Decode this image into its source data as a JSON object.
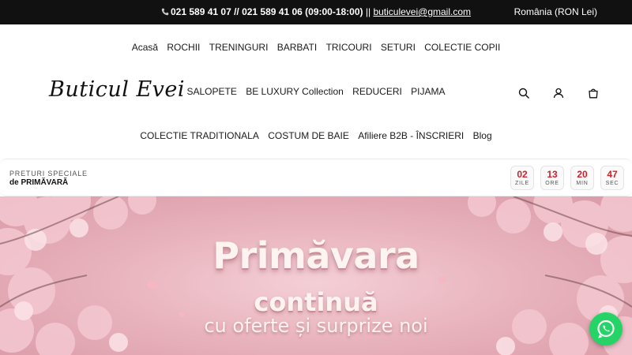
{
  "topbar": {
    "phone_text": "021 589 41 07 // 021 589 41 06 (09:00-18:00)",
    "separator": " || ",
    "email": "buticulevei@gmail.com",
    "region": "România (RON Lei)"
  },
  "header": {
    "logo": "Buticul Evei",
    "nav_row1": [
      "Acasă",
      "ROCHII",
      "TRENINGURI",
      "BARBATI",
      "TRICOURI",
      "SETURI",
      "COLECTIE COPII"
    ],
    "nav_row2": [
      "SALOPETE",
      "BE LUXURY Collection",
      "REDUCERI",
      "PIJAMA"
    ],
    "nav_row3": [
      "COLECTIE TRADITIONALA",
      "COSTUM DE BAIE",
      "Afiliere B2B - ÎNSCRIERI",
      "Blog"
    ],
    "icons": [
      "search-icon",
      "user-icon",
      "cart-icon"
    ]
  },
  "promo": {
    "label_top": "PRETURI SPECIALE",
    "label_bottom": "de PRIMĂVARĂ",
    "countdown": [
      {
        "value": "02",
        "unit": "ZILE"
      },
      {
        "value": "13",
        "unit": "ORE"
      },
      {
        "value": "20",
        "unit": "MIN"
      },
      {
        "value": "47",
        "unit": "SEC"
      }
    ]
  },
  "hero": {
    "title_line1": "Primăvara",
    "title_line2": "continuă",
    "title_line3": "cu oferte și surprize noi"
  },
  "colors": {
    "accent_red": "#d0202a",
    "topbar_bg": "#111111",
    "whatsapp_green": "#25d366"
  }
}
